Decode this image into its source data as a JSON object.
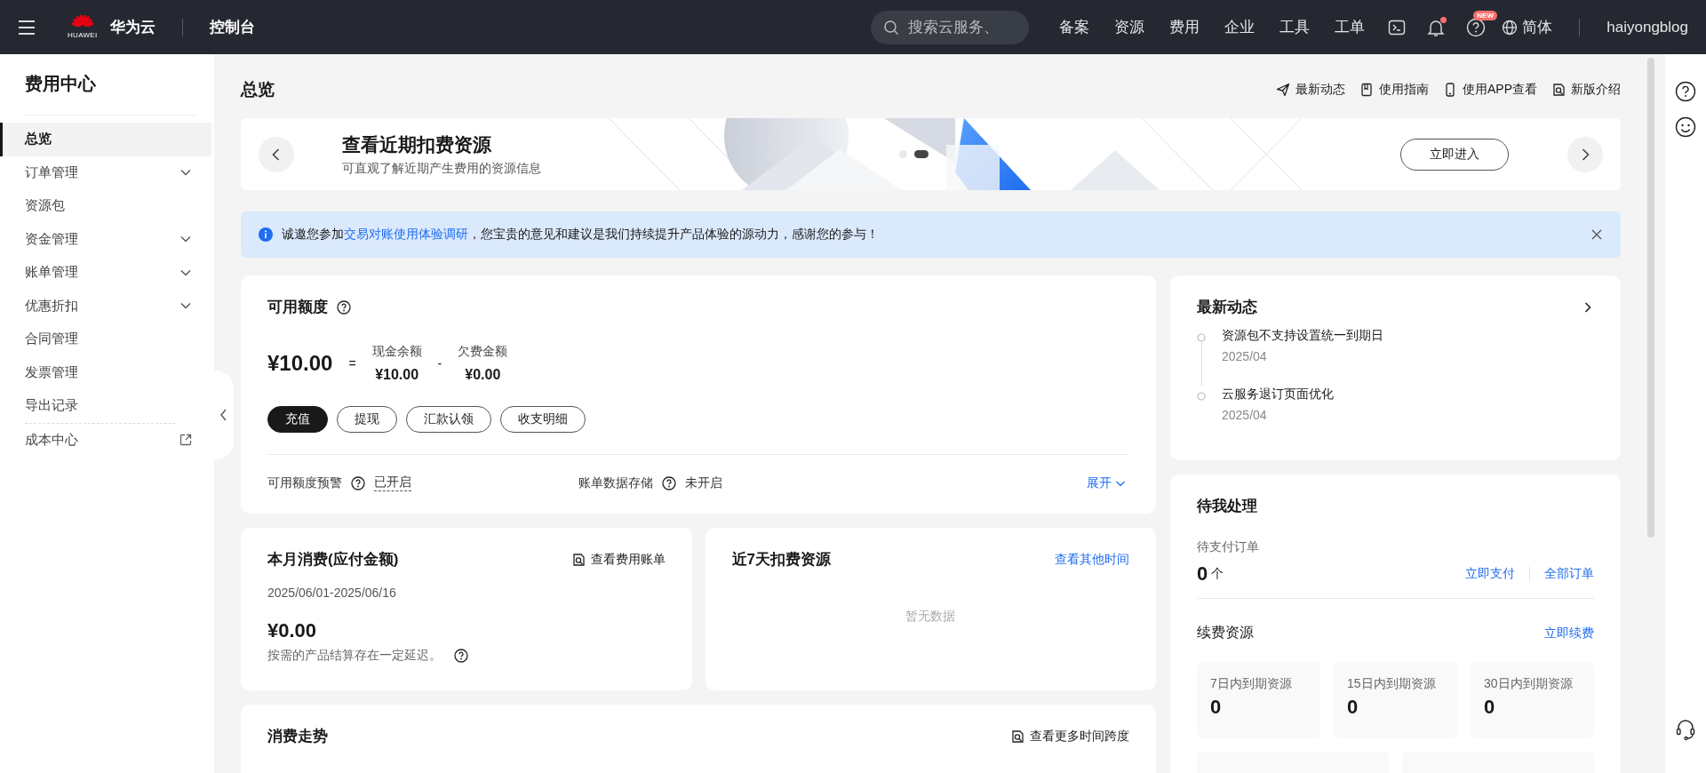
{
  "topbar": {
    "brand_small": "HUAWEI",
    "brand": "华为云",
    "console": "控制台",
    "search_placeholder": "搜索云服务、",
    "nav": [
      "备案",
      "资源",
      "费用",
      "企业",
      "工具",
      "工单"
    ],
    "has_notification": true,
    "help_badge": "NEW",
    "language": "简体",
    "user": "haiyongblog"
  },
  "sidebar": {
    "title": "费用中心",
    "items": [
      {
        "label": "总览",
        "kind": "plain",
        "selected": true
      },
      {
        "label": "订单管理",
        "kind": "expand",
        "selected": false
      },
      {
        "label": "资源包",
        "kind": "plain",
        "selected": false
      },
      {
        "label": "资金管理",
        "kind": "expand",
        "selected": false
      },
      {
        "label": "账单管理",
        "kind": "expand",
        "selected": false
      },
      {
        "label": "优惠折扣",
        "kind": "expand",
        "selected": false
      },
      {
        "label": "合同管理",
        "kind": "plain",
        "selected": false
      },
      {
        "label": "发票管理",
        "kind": "plain",
        "selected": false
      },
      {
        "label": "导出记录",
        "kind": "plain",
        "selected": false
      },
      {
        "label": "成本中心",
        "kind": "external",
        "selected": false
      }
    ]
  },
  "page": {
    "title": "总览",
    "links": [
      "最新动态",
      "使用指南",
      "使用APP查看",
      "新版介绍"
    ]
  },
  "banner": {
    "title": "查看近期扣费资源",
    "subtitle": "可直观了解近期产生费用的资源信息",
    "button": "立即进入",
    "dots": [
      {
        "selected": false
      },
      {
        "selected": true
      }
    ]
  },
  "alert": {
    "before": "诚邀您参加",
    "link": "交易对账使用体验调研",
    "after": "，您宝贵的意见和建议是我们持续提升产品体验的源动力，感谢您的参与！"
  },
  "balance": {
    "title": "可用额度",
    "total": "¥10.00",
    "equals": "=",
    "parts": [
      {
        "label": "现金余额",
        "value": "¥10.00"
      },
      {
        "label": "欠费金额",
        "value": "¥0.00"
      }
    ],
    "minus": "-",
    "buttons": [
      {
        "label": "充值",
        "primary": true
      },
      {
        "label": "提现",
        "primary": false
      },
      {
        "label": "汇款认领",
        "primary": false
      },
      {
        "label": "收支明细",
        "primary": false
      }
    ],
    "settings": [
      {
        "label": "可用额度预警",
        "value": "已开启",
        "underlined": true
      },
      {
        "label": "账单数据存储",
        "value": "未开启",
        "underlined": false
      }
    ],
    "expand": "展开"
  },
  "month": {
    "title": "本月消费(应付金额)",
    "link": "查看费用账单",
    "period": "2025/06/01-2025/06/16",
    "amount": "¥0.00",
    "note": "按需的产品结算存在一定延迟。"
  },
  "recent": {
    "title": "近7天扣费资源",
    "link": "查看其他时间",
    "empty": "暂无数据"
  },
  "trend": {
    "title": "消费走势",
    "link": "查看更多时间跨度"
  },
  "news": {
    "title": "最新动态",
    "items": [
      {
        "title": "资源包不支持设置统一到期日",
        "date": "2025/04"
      },
      {
        "title": "云服务退订页面优化",
        "date": "2025/04"
      }
    ]
  },
  "todo": {
    "title": "待我处理",
    "pending_label": "待支付订单",
    "count": "0",
    "unit": "个",
    "links": [
      "立即支付",
      "全部订单"
    ],
    "renew_title": "续费资源",
    "renew_link": "立即续费",
    "stats": [
      {
        "label": "7日内到期资源",
        "value": "0"
      },
      {
        "label": "15日内到期资源",
        "value": "0"
      },
      {
        "label": "30日内到期资源",
        "value": "0"
      }
    ]
  }
}
